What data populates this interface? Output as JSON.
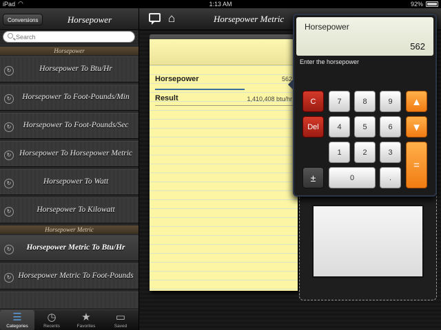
{
  "status": {
    "carrier": "iPad",
    "time": "1:13 AM",
    "battery": "92%"
  },
  "sidebar": {
    "back_label": "Conversions",
    "title": "Horsepower",
    "search_placeholder": "Search",
    "section1": "Horsepower",
    "section2": "Horsepower Metric",
    "items": [
      {
        "label": "Horsepower To Btu/Hr"
      },
      {
        "label": "Horsepower To Foot-Pounds/Min"
      },
      {
        "label": "Horsepower To Foot-Pounds/Sec"
      },
      {
        "label": "Horsepower To Horsepower Metric"
      },
      {
        "label": "Horsepower To Watt"
      },
      {
        "label": "Horsepower To Kilowatt"
      },
      {
        "label": "Horsepower Metric To Btu/Hr"
      },
      {
        "label": "Horsepower Metric To Foot-Pounds"
      }
    ]
  },
  "tabs": [
    {
      "label": "Categories",
      "icon": "list-icon"
    },
    {
      "label": "Recents",
      "icon": "clock-icon"
    },
    {
      "label": "Favorites",
      "icon": "star-icon"
    },
    {
      "label": "Saved",
      "icon": "folder-icon"
    }
  ],
  "main": {
    "title": "Horsepower Metric",
    "input_label": "Horsepower",
    "input_value": "562",
    "result_label": "Result",
    "result_value": "1,410,408 btu/hr"
  },
  "calc": {
    "display_label": "Horsepower",
    "display_value": "562",
    "prompt": "Enter the horsepower",
    "keys": {
      "clear": "C",
      "delete": "Del",
      "plusminus": "±",
      "equals": "=",
      "up": "▲",
      "down": "▼",
      "k0": "0",
      "k1": "1",
      "k2": "2",
      "k3": "3",
      "k4": "4",
      "k5": "5",
      "k6": "6",
      "k7": "7",
      "k8": "8",
      "k9": "9",
      "dot": "."
    }
  },
  "colors": {
    "accent": "#5aa0e0",
    "key_red": "#c22a1e",
    "key_orange": "#f78e22"
  }
}
